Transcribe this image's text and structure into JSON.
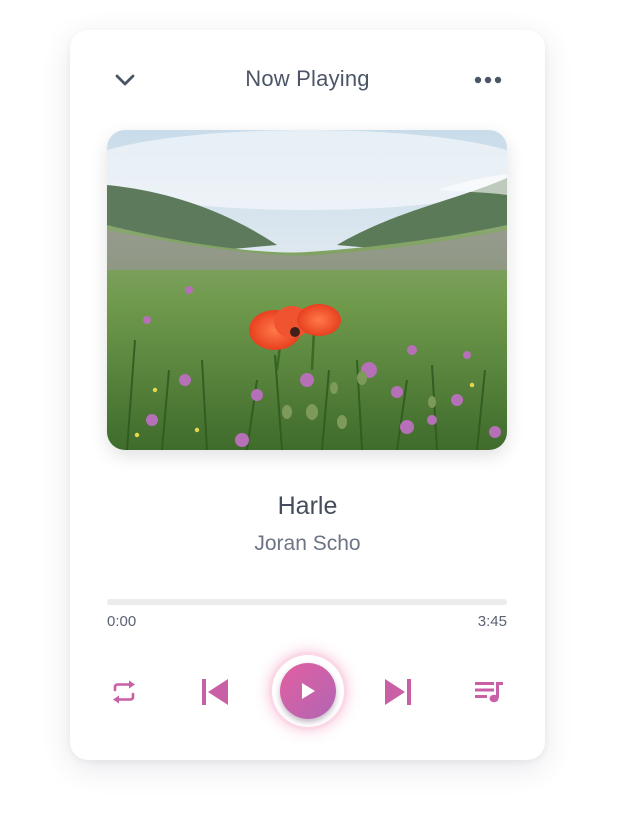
{
  "header": {
    "title": "Now Playing"
  },
  "track": {
    "name": "Harle",
    "artist": "Joran Scho"
  },
  "progress": {
    "current": "0:00",
    "duration": "3:45",
    "fraction": 0
  },
  "icons": {
    "collapse": "chevron-down-icon",
    "menu": "more-dots-icon",
    "repeat": "repeat-icon",
    "previous": "skip-previous-icon",
    "play": "play-icon",
    "next": "skip-next-icon",
    "queue": "playlist-icon"
  },
  "colors": {
    "accent_start": "#e8609a",
    "accent_end": "#a066b8",
    "control": "#c95fa4",
    "text_primary": "#454d5c",
    "text_secondary": "#6c7485"
  }
}
